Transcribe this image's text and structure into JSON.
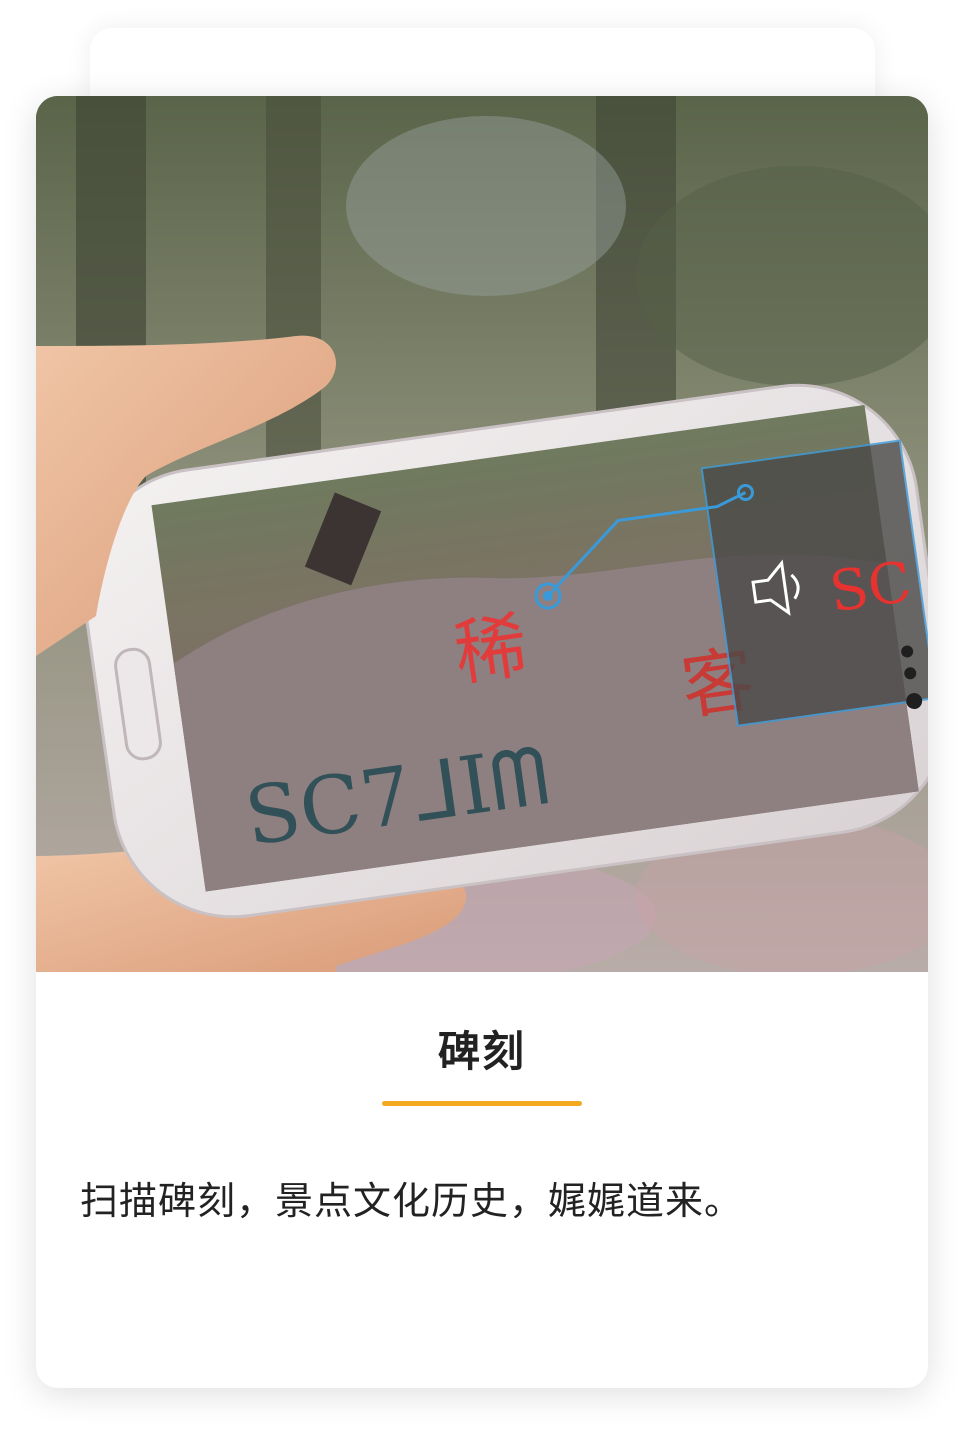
{
  "card": {
    "title": "碑刻",
    "description": "扫描碑刻，景点文化历史，娓娓道来。",
    "accent_color": "#f5a91e"
  },
  "photo": {
    "icons": [
      "speaker-icon",
      "menu-dots-icon",
      "location-pin-icon"
    ],
    "accent_color": "#3a9ad9"
  }
}
